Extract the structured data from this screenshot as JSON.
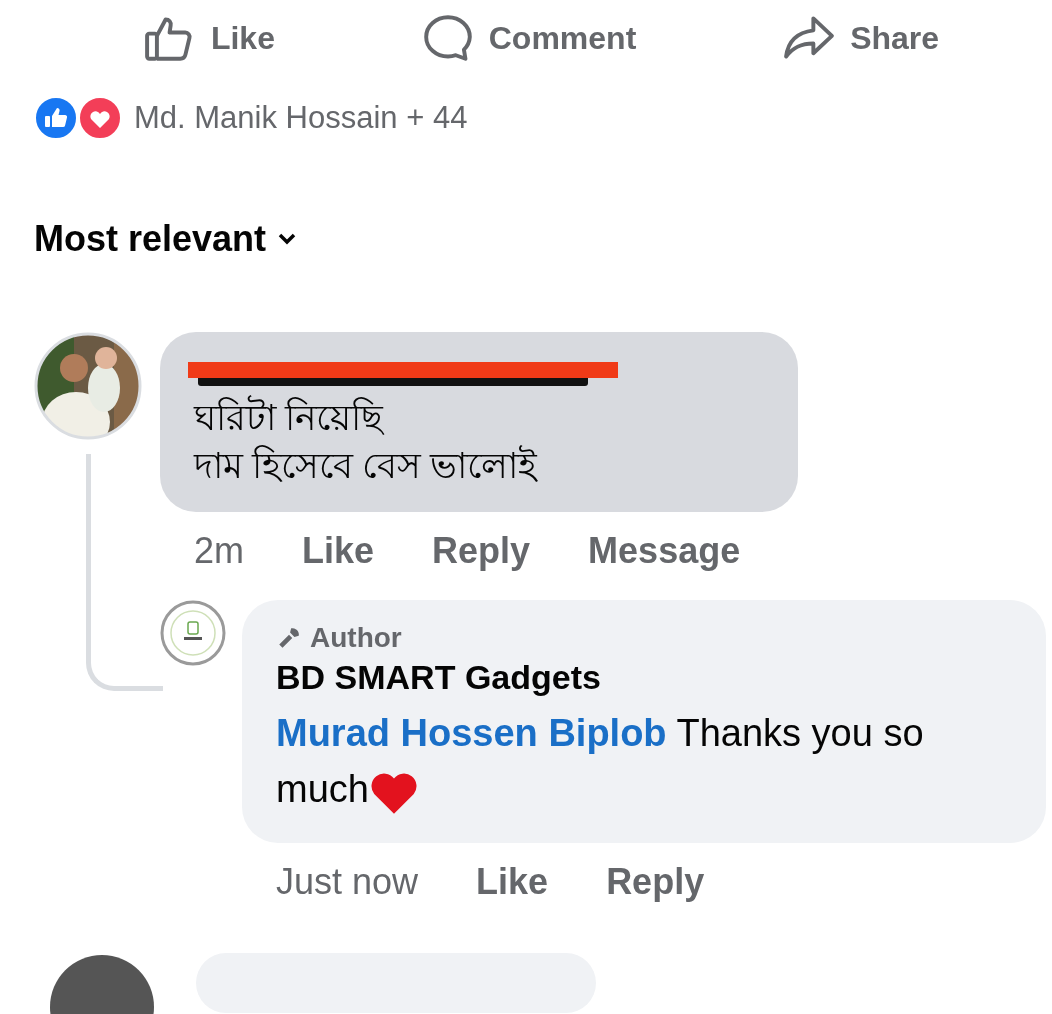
{
  "actions": [
    {
      "kind": "like",
      "label": "Like"
    },
    {
      "kind": "comment",
      "label": "Comment"
    },
    {
      "kind": "share",
      "label": "Share"
    }
  ],
  "reactions": {
    "summary": "Md. Manik Hossain + 44"
  },
  "sort": {
    "label": "Most relevant"
  },
  "comment": {
    "redacted": true,
    "lines": [
      "ঘরিটা নিয়েছি",
      "দাম হিসেবে বেস ভালোই"
    ],
    "time": "2m",
    "links": [
      "Like",
      "Reply",
      "Message"
    ]
  },
  "reply": {
    "badge": "Author",
    "author": "BD SMART Gadgets",
    "mention": "Murad Hossen Biplob",
    "text": " Thanks you so much",
    "time": "Just now",
    "links": [
      "Like",
      "Reply"
    ]
  }
}
